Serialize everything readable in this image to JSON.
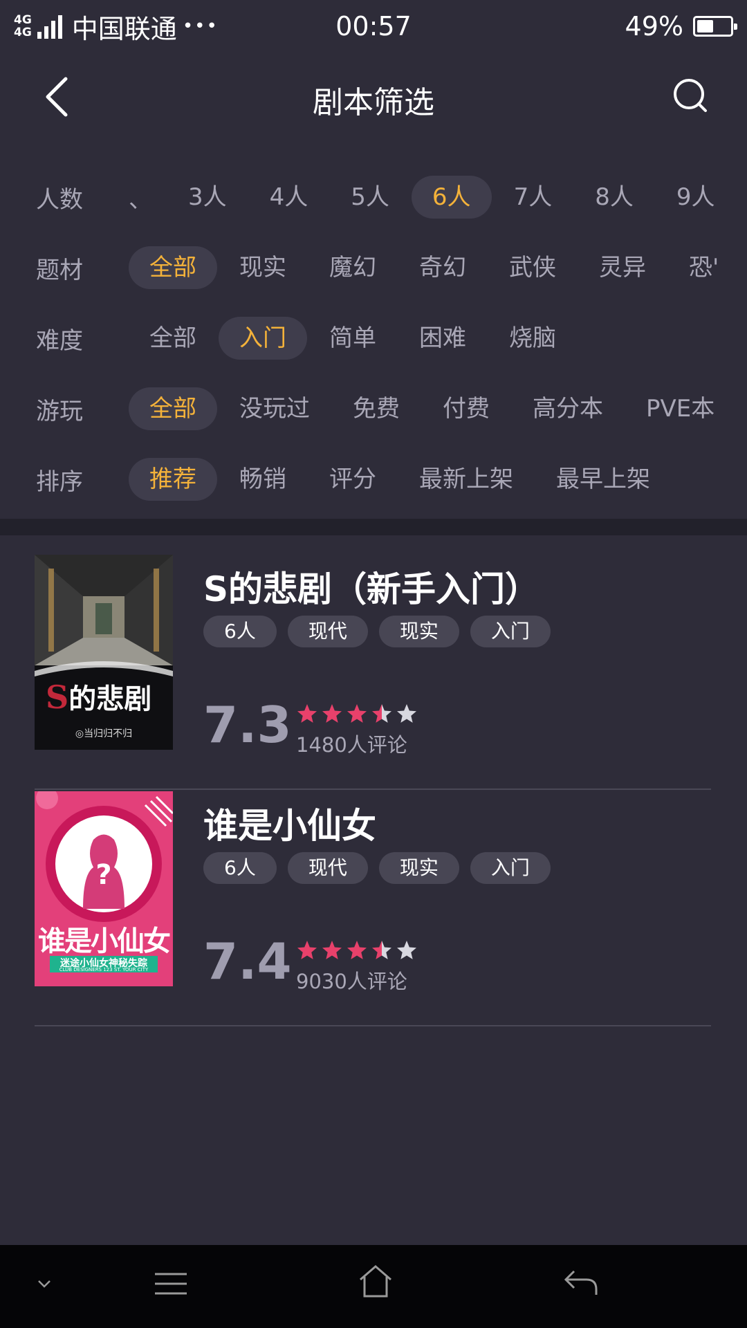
{
  "status_bar": {
    "network_top": "4G",
    "network_bottom": "4G",
    "carrier": "中国联通",
    "dots": "•••",
    "time": "00:57",
    "battery": "49%",
    "battery_level": 0.49
  },
  "header": {
    "title": "剧本筛选",
    "back_icon": "back-arrow-icon",
    "search_icon": "search-icon"
  },
  "filters": [
    {
      "label": "人数",
      "partial_left": "、",
      "options": [
        "3人",
        "4人",
        "5人",
        "6人",
        "7人",
        "8人",
        "9人"
      ],
      "active": "6人"
    },
    {
      "label": "题材",
      "options": [
        "全部",
        "现实",
        "魔幻",
        "奇幻",
        "武侠",
        "灵异",
        "恐'"
      ],
      "active": "全部"
    },
    {
      "label": "难度",
      "options": [
        "全部",
        "入门",
        "简单",
        "困难",
        "烧脑"
      ],
      "active": "入门"
    },
    {
      "label": "游玩",
      "options": [
        "全部",
        "没玩过",
        "免费",
        "付费",
        "高分本",
        "PVE本"
      ],
      "active": "全部"
    },
    {
      "label": "排序",
      "options": [
        "推荐",
        "畅销",
        "评分",
        "最新上架",
        "最早上架"
      ],
      "active": "推荐"
    }
  ],
  "colors": {
    "background": "#2e2c39",
    "accent": "#f4b23a",
    "star_on": "#e8416b",
    "star_off": "#d8d8e0"
  },
  "scripts": [
    {
      "title": "S的悲剧（新手入门）",
      "tags": [
        "6人",
        "现代",
        "现实",
        "入门"
      ],
      "score": "7.3",
      "stars": 3.5,
      "reviews": "1480人评论",
      "cover": {
        "big_text_s": "S",
        "big_text": "的悲剧",
        "small_text": "◎当归归不归"
      }
    },
    {
      "title": "谁是小仙女",
      "tags": [
        "6人",
        "现代",
        "现实",
        "入门"
      ],
      "score": "7.4",
      "stars": 3.5,
      "reviews": "9030人评论",
      "cover": {
        "big_text": "谁是小仙女",
        "banner": "迷途小仙女神秘失踪",
        "banner_small": "CLUB DESIGNERS 123 ST. YOUR CITY",
        "question": "?"
      }
    }
  ],
  "system_nav": {
    "icons": [
      "chevron-down-icon",
      "menu-icon",
      "home-icon",
      "return-icon"
    ]
  }
}
